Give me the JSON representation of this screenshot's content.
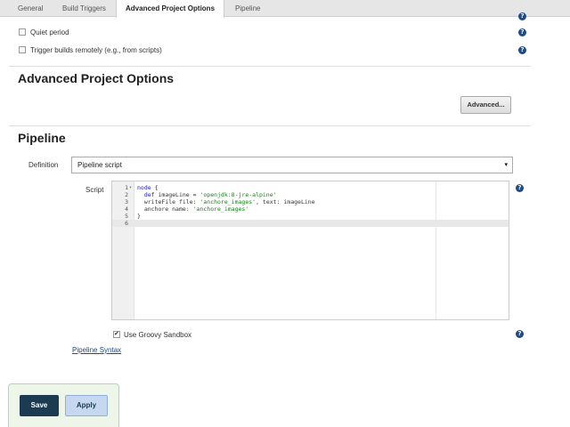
{
  "tabs": [
    {
      "label": "General"
    },
    {
      "label": "Build Triggers"
    },
    {
      "label": "Advanced Project Options",
      "active": true
    },
    {
      "label": "Pipeline"
    }
  ],
  "build_triggers": {
    "quiet_period_label": "Quiet period",
    "trigger_remote_label": "Trigger builds remotely (e.g., from scripts)"
  },
  "advanced_project_options": {
    "title": "Advanced Project Options",
    "advanced_button": "Advanced..."
  },
  "pipeline": {
    "title": "Pipeline",
    "definition_label": "Definition",
    "definition_value": "Pipeline script",
    "script_label": "Script",
    "script_lines": [
      "node {",
      "  def imageLine = 'openjdk:8-jre-alpine'",
      "  writeFile file: 'anchore_images', text: imageLine",
      "  anchore name: 'anchore_images'",
      "}",
      ""
    ],
    "line_numbers": [
      "1",
      "2",
      "3",
      "4",
      "5",
      "6"
    ],
    "sandbox_label": "Use Groovy Sandbox",
    "sandbox_checked": true,
    "syntax_link": "Pipeline Syntax"
  },
  "footer": {
    "save_label": "Save",
    "apply_label": "Apply"
  },
  "icons": {
    "help": "?",
    "dropdown_arrow": "▾",
    "fold_arrow": "▾"
  },
  "colors": {
    "help_icon": "#204a87",
    "save_button": "#1d3b50",
    "apply_button": "#c6d8f0",
    "link": "#204a87"
  }
}
